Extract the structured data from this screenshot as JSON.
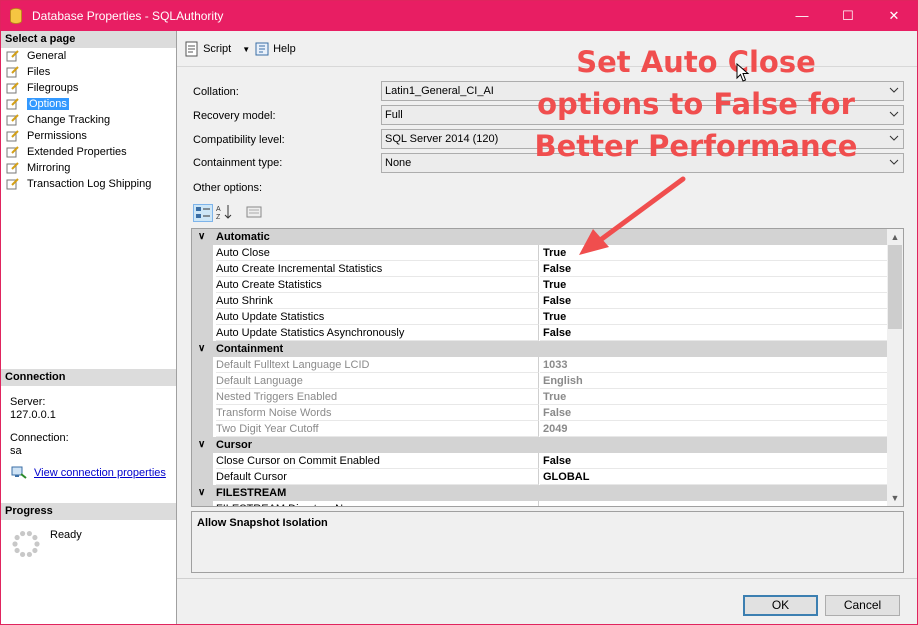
{
  "window": {
    "title": "Database Properties - SQLAuthority",
    "minimize": "—",
    "maximize": "☐",
    "close": "✕"
  },
  "sidebar": {
    "select_header": "Select a page",
    "pages": [
      "General",
      "Files",
      "Filegroups",
      "Options",
      "Change Tracking",
      "Permissions",
      "Extended Properties",
      "Mirroring",
      "Transaction Log Shipping"
    ],
    "selected": "Options",
    "connection_header": "Connection",
    "server_label": "Server:",
    "server_value": "127.0.0.1",
    "connection_label": "Connection:",
    "connection_value": "sa",
    "view_link": "View connection properties",
    "progress_header": "Progress",
    "progress_status": "Ready"
  },
  "toolbar": {
    "script": "Script",
    "help": "Help"
  },
  "form": {
    "collation_label": "Collation:",
    "collation_value": "Latin1_General_CI_AI",
    "recovery_label": "Recovery model:",
    "recovery_value": "Full",
    "compat_label": "Compatibility level:",
    "compat_value": "SQL Server 2014 (120)",
    "containment_label": "Containment type:",
    "containment_value": "None",
    "other_label": "Other options:"
  },
  "grid": {
    "rows": [
      {
        "kind": "cat",
        "label": "Automatic"
      },
      {
        "kind": "prop",
        "name": "Auto Close",
        "value": "True"
      },
      {
        "kind": "prop",
        "name": "Auto Create Incremental Statistics",
        "value": "False"
      },
      {
        "kind": "prop",
        "name": "Auto Create Statistics",
        "value": "True"
      },
      {
        "kind": "prop",
        "name": "Auto Shrink",
        "value": "False"
      },
      {
        "kind": "prop",
        "name": "Auto Update Statistics",
        "value": "True"
      },
      {
        "kind": "prop",
        "name": "Auto Update Statistics Asynchronously",
        "value": "False"
      },
      {
        "kind": "cat",
        "label": "Containment"
      },
      {
        "kind": "prop",
        "name": "Default Fulltext Language LCID",
        "value": "1033",
        "disabled": true
      },
      {
        "kind": "prop",
        "name": "Default Language",
        "value": "English",
        "disabled": true
      },
      {
        "kind": "prop",
        "name": "Nested Triggers Enabled",
        "value": "True",
        "disabled": true
      },
      {
        "kind": "prop",
        "name": "Transform Noise Words",
        "value": "False",
        "disabled": true
      },
      {
        "kind": "prop",
        "name": "Two Digit Year Cutoff",
        "value": "2049",
        "disabled": true
      },
      {
        "kind": "cat",
        "label": "Cursor"
      },
      {
        "kind": "prop",
        "name": "Close Cursor on Commit Enabled",
        "value": "False"
      },
      {
        "kind": "prop",
        "name": "Default Cursor",
        "value": "GLOBAL"
      },
      {
        "kind": "cat",
        "label": "FILESTREAM"
      },
      {
        "kind": "prop",
        "name": "FILESTREAM Directory Name",
        "value": ""
      }
    ],
    "description_title": "Allow Snapshot Isolation"
  },
  "buttons": {
    "ok": "OK",
    "cancel": "Cancel"
  },
  "annotation": {
    "line1": "Set Auto Close",
    "line2": "options to False for",
    "line3": "Better Performance",
    "color": "#f04e4e"
  },
  "colors": {
    "titlebar": "#e81e63",
    "selection": "#3399ff",
    "category": "#d3d3d3"
  }
}
